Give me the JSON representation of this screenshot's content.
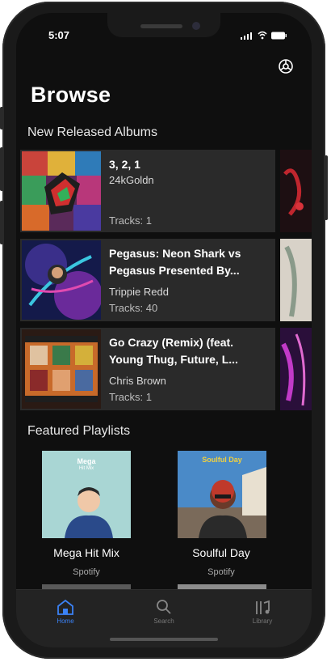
{
  "status_bar": {
    "time": "5:07"
  },
  "header": {
    "title": "Browse"
  },
  "new_releases": {
    "heading": "New Released Albums",
    "albums": [
      {
        "title": "3, 2, 1",
        "artist": "24kGoldn",
        "tracks": "Tracks: 1"
      },
      {
        "title": "Pegasus: Neon Shark vs Pegasus Presented By...",
        "artist": "Trippie Redd",
        "tracks": "Tracks: 40"
      },
      {
        "title": "Go Crazy (Remix) (feat. Young Thug, Future, L...",
        "artist": "Chris Brown",
        "tracks": "Tracks: 1"
      }
    ]
  },
  "featured": {
    "heading": "Featured Playlists",
    "playlists": [
      {
        "name": "Mega Hit Mix",
        "owner": "Spotify",
        "cover_text": "Mega",
        "cover_subtext": "Hit Mix"
      },
      {
        "name": "Soulful Day",
        "owner": "Spotify",
        "cover_text": "Soulful Day"
      }
    ]
  },
  "tabbar": {
    "tabs": [
      {
        "label": "Home",
        "icon": "home-icon",
        "active": true
      },
      {
        "label": "Search",
        "icon": "search-icon",
        "active": false
      },
      {
        "label": "Library",
        "icon": "library-icon",
        "active": false
      }
    ]
  },
  "colors": {
    "accent": "#3b82f6",
    "background": "#0f0f0f",
    "card": "#2a2a2a"
  }
}
